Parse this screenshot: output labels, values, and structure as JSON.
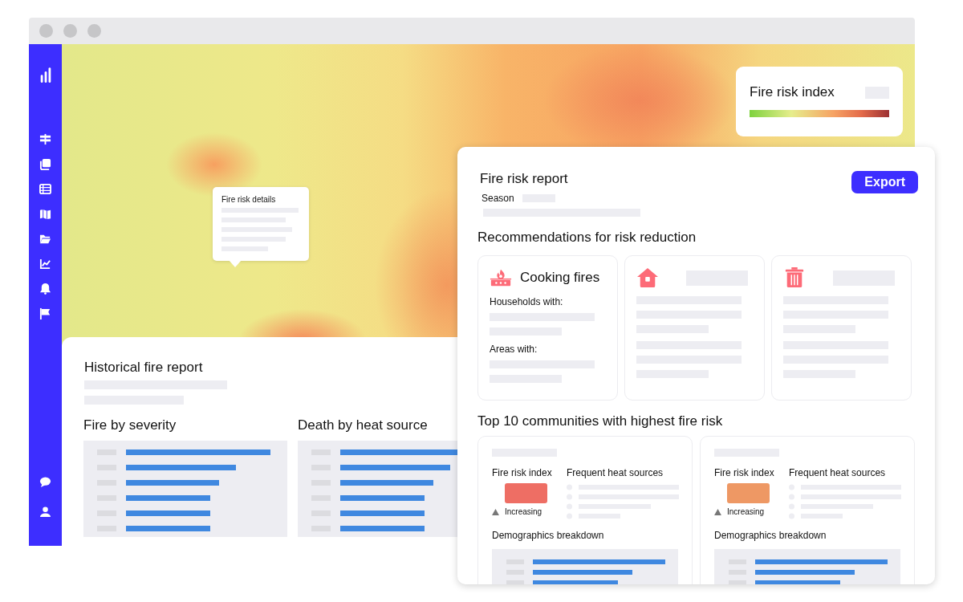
{
  "map": {
    "tooltip": {
      "title": "Fire risk details"
    },
    "legend": {
      "title": "Fire risk index"
    }
  },
  "historical_report": {
    "title": "Historical fire report",
    "charts": [
      {
        "title": "Fire by severity"
      },
      {
        "title": "Death by heat source"
      }
    ]
  },
  "fire_risk_report": {
    "title": "Fire risk report",
    "season_label": "Season",
    "export_button": "Export",
    "recommendations": {
      "title": "Recommendations for risk reduction",
      "cards": [
        {
          "kind": "stove",
          "title": "Cooking fires",
          "sections": [
            "Households with:",
            "Areas with:"
          ]
        },
        {
          "kind": "house"
        },
        {
          "kind": "trash"
        }
      ]
    },
    "communities": {
      "title": "Top 10 communities with highest fire risk",
      "cards": [
        {
          "index_label": "Fire risk index",
          "color": "#ee6e64",
          "trend": "Increasing",
          "heat_label": "Frequent heat sources",
          "demographics_label": "Demographics breakdown"
        },
        {
          "index_label": "Fire risk index",
          "color": "#ee9864",
          "trend": "Increasing",
          "heat_label": "Frequent heat sources",
          "demographics_label": "Demographics breakdown"
        }
      ]
    }
  }
}
